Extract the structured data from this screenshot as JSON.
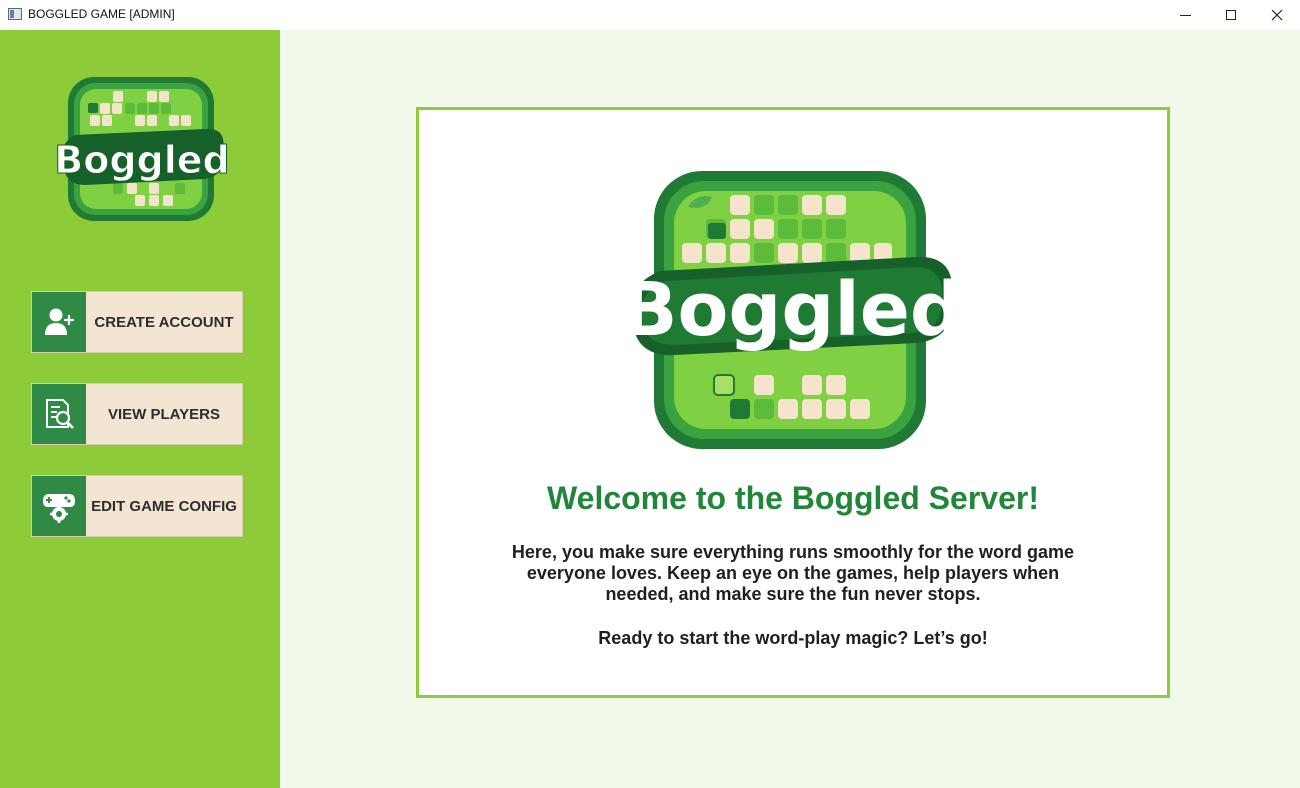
{
  "window": {
    "title": "BOGGLED GAME [ADMIN]"
  },
  "sidebar": {
    "logo_text": "Boggled",
    "buttons": [
      {
        "label": "CREATE ACCOUNT",
        "icon": "add-user-icon"
      },
      {
        "label": "VIEW PLAYERS",
        "icon": "search-document-icon"
      },
      {
        "label": "EDIT GAME CONFIG",
        "icon": "gamepad-gear-icon"
      }
    ]
  },
  "main": {
    "logo_text": "Boggled",
    "welcome": "Welcome to the Boggled Server!",
    "description": "Here, you make sure everything runs smoothly for the word game everyone loves. Keep an eye on the games, help players when needed, and make sure the fun never stops.",
    "cta": "Ready to start the word-play magic? Let’s go!"
  },
  "colors": {
    "sidebar_bg": "#8dcc38",
    "main_bg": "#f1f9ea",
    "accent_green": "#22863a",
    "button_bg": "#f2e6d3",
    "button_icon_bg": "#2e8a45"
  }
}
